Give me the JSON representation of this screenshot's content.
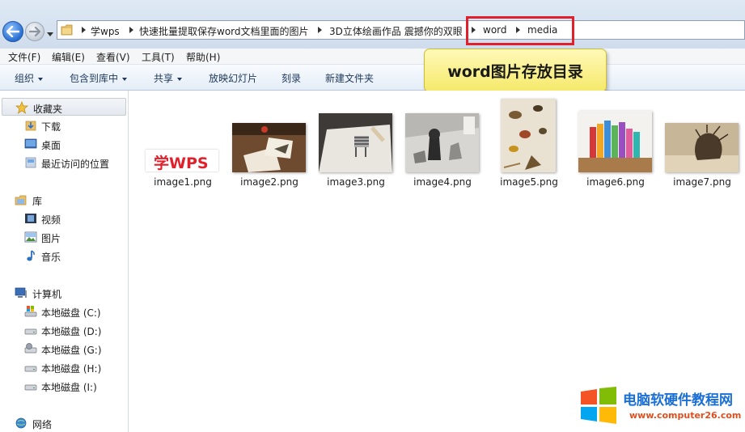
{
  "address": {
    "crumbs": [
      "学wps",
      "快速批量提取保存word文档里面的图片",
      "3D立体绘画作品 震撼你的双眼",
      "word",
      "media"
    ]
  },
  "menu": [
    "文件(F)",
    "编辑(E)",
    "查看(V)",
    "工具(T)",
    "帮助(H)"
  ],
  "toolbar": {
    "organize": "组织",
    "include_library": "包含到库中",
    "share": "共享",
    "slideshow": "放映幻灯片",
    "burn": "刻录",
    "new_folder": "新建文件夹"
  },
  "callout": "word图片存放目录",
  "nav": {
    "favorites": "收藏夹",
    "downloads": "下载",
    "desktop": "桌面",
    "recent": "最近访问的位置",
    "libraries": "库",
    "videos": "视频",
    "pictures": "图片",
    "music": "音乐",
    "computer": "计算机",
    "drives": [
      "本地磁盘 (C:)",
      "本地磁盘 (D:)",
      "本地磁盘 (G:)",
      "本地磁盘 (H:)",
      "本地磁盘 (I:)"
    ],
    "network": "网络"
  },
  "files": [
    {
      "name": "image1.png",
      "logo_text": "学WPS"
    },
    {
      "name": "image2.png"
    },
    {
      "name": "image3.png"
    },
    {
      "name": "image4.png"
    },
    {
      "name": "image5.png"
    },
    {
      "name": "image6.png"
    },
    {
      "name": "image7.png"
    }
  ],
  "watermark": {
    "title": "电脑软硬件教程网",
    "url": "www.computer26.com"
  },
  "colors": {
    "highlight": "#e0202a",
    "callout_bg": "#f8ee8a",
    "watermark_blue": "#1a6fd6",
    "watermark_orange": "#e04e1c"
  }
}
